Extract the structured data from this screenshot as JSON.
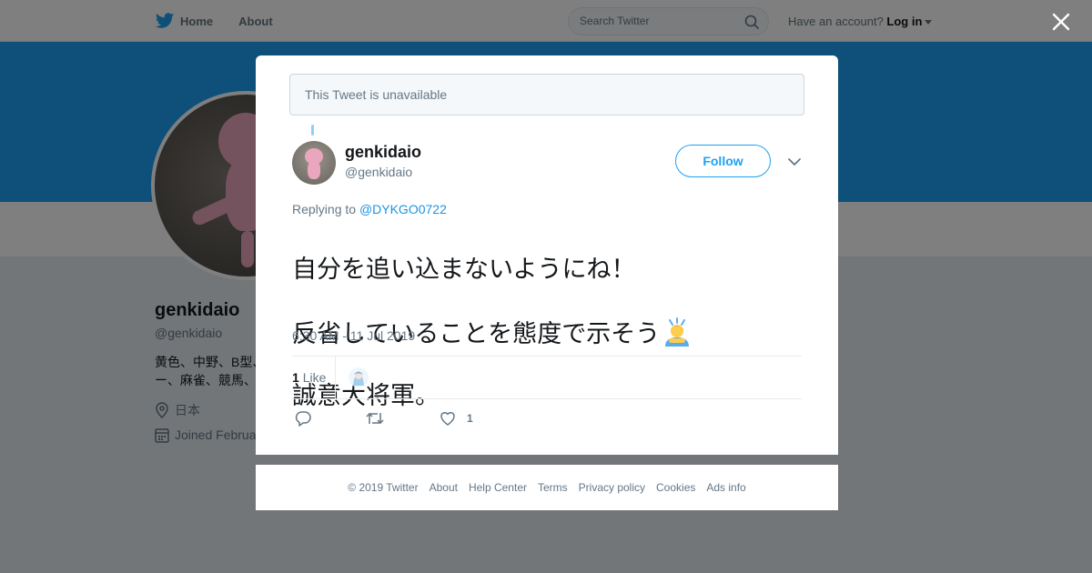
{
  "topbar": {
    "nav": [
      {
        "label": "Home"
      },
      {
        "label": "About"
      }
    ],
    "search_placeholder": "Search Twitter",
    "account_prompt": "Have an account?",
    "login_label": "Log in"
  },
  "profile": {
    "name": "genkidaio",
    "handle": "@genkidaio",
    "bio_line1": "黄色、中野、B型、",
    "bio_line2": "ー、麻雀、競馬、",
    "location": "日本",
    "joined": "Joined Februa"
  },
  "modal": {
    "unavailable_text": "This Tweet is unavailable",
    "tweet": {
      "name": "genkidaio",
      "handle": "@genkidaio",
      "follow_label": "Follow",
      "replying_prefix": "Replying to",
      "replying_to": "@DYKGO0722",
      "text_line1": "自分を追い込まないようにね！",
      "text_line2": "反省していることを態度で示そう",
      "text_line3": "誠意大将軍。",
      "timestamp": "6:30 AM - 11 Jul 2019",
      "like_count": "1",
      "like_label": "Like",
      "like_action_count": "1"
    }
  },
  "footer": {
    "links": [
      "© 2019 Twitter",
      "About",
      "Help Center",
      "Terms",
      "Privacy policy",
      "Cookies",
      "Ads info"
    ]
  },
  "icons": {
    "logo": "twitter-bird-icon",
    "search": "search-icon",
    "close": "close-icon",
    "more": "chevron-down-icon",
    "reply": "reply-icon",
    "retweet": "retweet-icon",
    "like": "heart-icon",
    "location": "location-pin-icon",
    "calendar": "calendar-icon"
  },
  "colors": {
    "accent": "#1da1f2",
    "link": "#1b95e0",
    "muted": "#657786"
  }
}
